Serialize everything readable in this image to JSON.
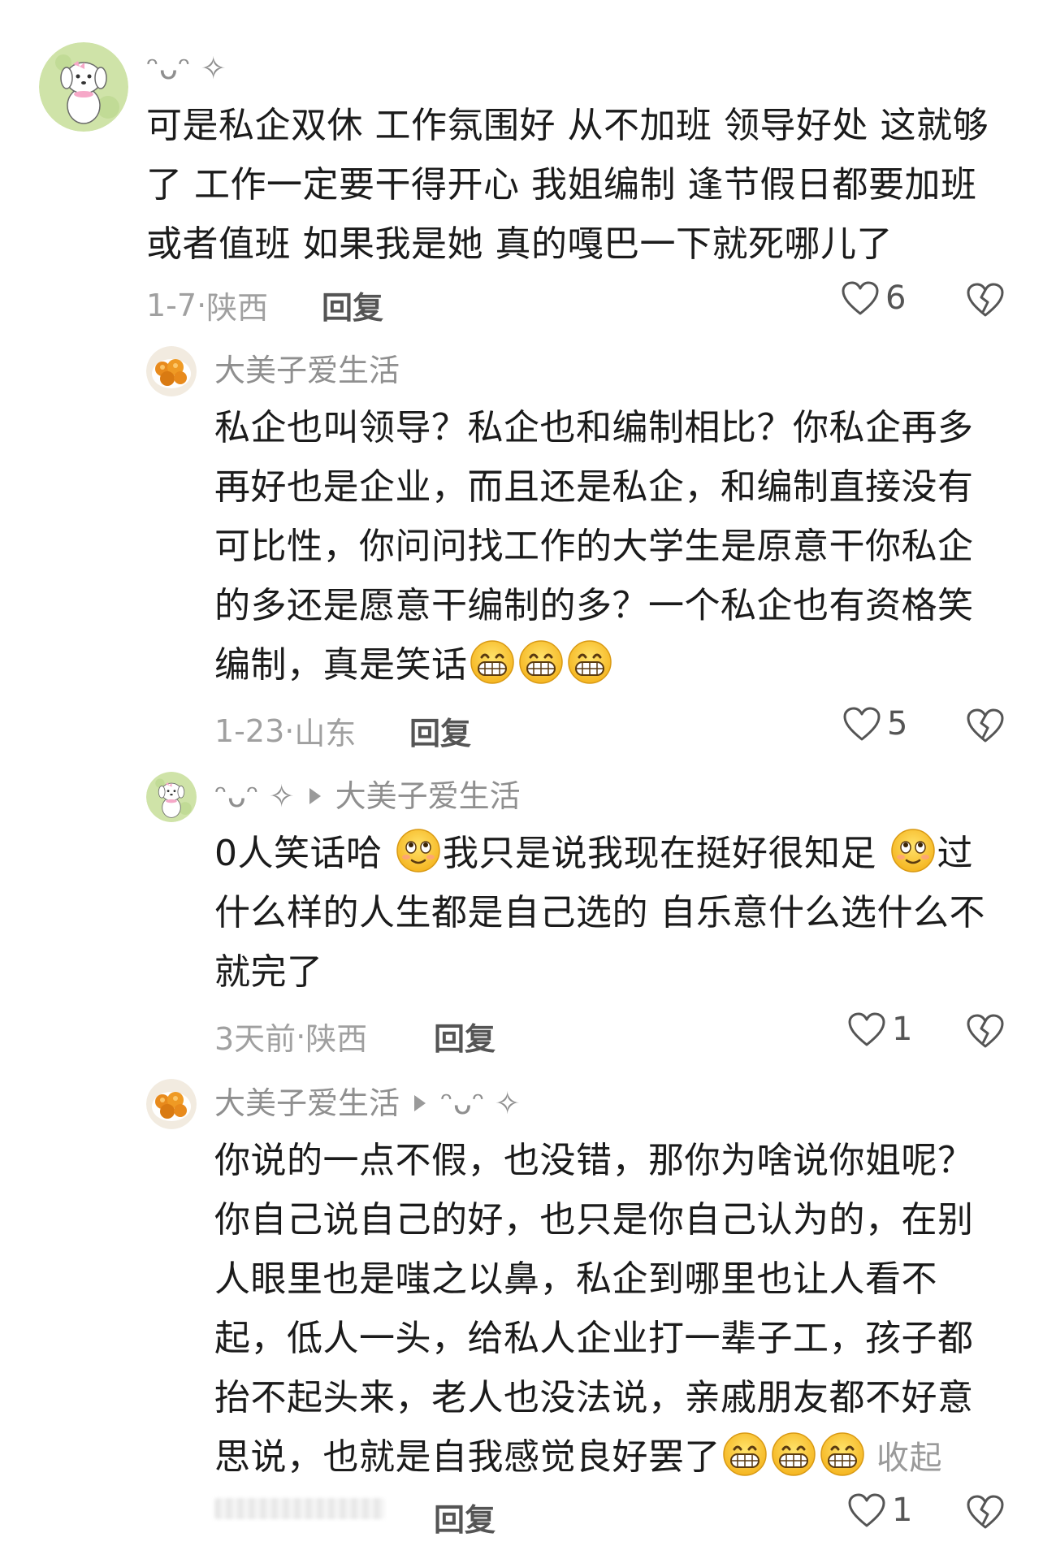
{
  "comments": [
    {
      "username": "ᵔᴗᵔ ✧",
      "text": "可是私企双休 工作氛围好 从不加班 领导好处 这就够了 工作一定要干得开心 我姐编制 逢节假日都要加班或者值班 如果我是她 真的嘎巴一下就死哪儿了",
      "lines": [
        "可是私企双休 工作氛围好 从不加班 领导好处 这就够",
        "了 工作一定要干得开心 我姐编制 逢节假日都要加班",
        "或者值班 如果我是她 真的嘎巴一下就死哪儿了"
      ],
      "date": "1-7",
      "location": "陕西",
      "reply_label": "回复",
      "likes": "6"
    },
    {
      "username": "大美子爱生活",
      "lines": [
        "私企也叫领导？私企也和编制相比？你私企再多",
        "再好也是企业，而且还是私企，和编制直接没有",
        "可比性，你问问找工作的大学生是原意干你私企",
        "的多还是愿意干编制的多？一个私企也有资格笑",
        "编制，真是笑话"
      ],
      "date": "1-23",
      "location": "山东",
      "reply_label": "回复",
      "likes": "5",
      "emoji": "grin-emoji"
    },
    {
      "username": "ᵔᴗᵔ ✧",
      "reply_to": "大美子爱生活",
      "line1_a": "0人笑话哈",
      "line1_b": "我只是说我现在挺好很知足",
      "line1_c": "过",
      "lines_rest": [
        "什么样的人生都是自己选的 自乐意什么选什么不",
        "就完了"
      ],
      "date": "3天前",
      "location": "陕西",
      "reply_label": "回复",
      "likes": "1",
      "emoji": "smirk-emoji"
    },
    {
      "username": "大美子爱生活",
      "reply_to": "ᵔᴗᵔ ✧",
      "lines": [
        "你说的一点不假，也没错，那你为啥说你姐呢？",
        "你自己说自己的好，也只是你自己认为的，在别",
        "人眼里也是嗤之以鼻，私企到哪里也让人看不",
        "起，低人一头，给私人企业打一辈子工，孩子都",
        "抬不起头来，老人也没法说，亲戚朋友都不好意",
        "思说，也就是自我感觉良好罢了"
      ],
      "collapse_label": "收起",
      "reply_label": "回复",
      "likes": "1",
      "emoji": "grin-emoji"
    }
  ],
  "colors": {
    "text": "#1b1b1b",
    "meta": "#a0a0a0",
    "username": "#8f8f8f"
  }
}
